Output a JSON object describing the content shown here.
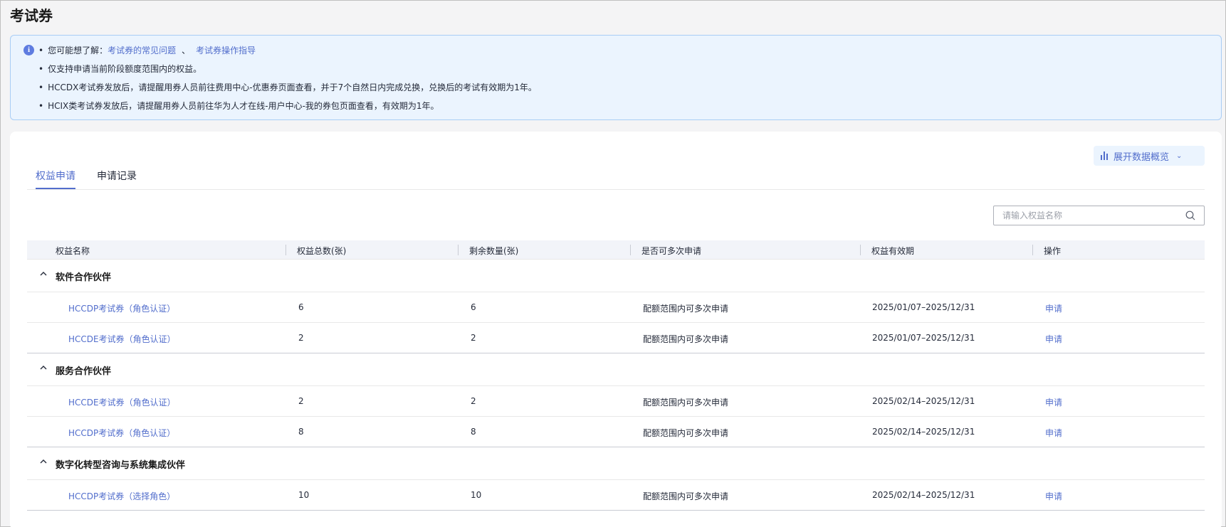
{
  "page": {
    "title": "考试券"
  },
  "notice": {
    "prefix": "您可能想了解：",
    "link1": "考试券的常见问题",
    "separator": "、",
    "link2": "考试券操作指导",
    "lines": [
      "仅支持申请当前阶段额度范围内的权益。",
      "HCCDX考试券发放后，请提醒用券人员前往费用中心-优惠券页面查看，并于7个自然日内完成兑换，兑换后的考试有效期为1年。",
      "HCIX类考试券发放后，请提醒用券人员前往华为人才在线-用户中心-我的券包页面查看，有效期为1年。"
    ]
  },
  "toolbar": {
    "expand_label": "展开数据概览"
  },
  "tabs": [
    {
      "label": "权益申请",
      "active": true
    },
    {
      "label": "申请记录",
      "active": false
    }
  ],
  "search": {
    "placeholder": "请输入权益名称",
    "value": ""
  },
  "table": {
    "columns": [
      "权益名称",
      "权益总数(张)",
      "剩余数量(张)",
      "是否可多次申请",
      "权益有效期",
      "操作"
    ],
    "groups": [
      {
        "name": "软件合作伙伴",
        "rows": [
          {
            "name": "HCCDP考试券（角色认证）",
            "total": "6",
            "remaining": "6",
            "multi": "配额范围内可多次申请",
            "validity": "2025/01/07–2025/12/31",
            "action": "申请"
          },
          {
            "name": "HCCDE考试券（角色认证）",
            "total": "2",
            "remaining": "2",
            "multi": "配额范围内可多次申请",
            "validity": "2025/01/07–2025/12/31",
            "action": "申请"
          }
        ]
      },
      {
        "name": "服务合作伙伴",
        "rows": [
          {
            "name": "HCCDE考试券（角色认证）",
            "total": "2",
            "remaining": "2",
            "multi": "配额范围内可多次申请",
            "validity": "2025/02/14–2025/12/31",
            "action": "申请"
          },
          {
            "name": "HCCDP考试券（角色认证）",
            "total": "8",
            "remaining": "8",
            "multi": "配额范围内可多次申请",
            "validity": "2025/02/14–2025/12/31",
            "action": "申请"
          }
        ]
      },
      {
        "name": "数字化转型咨询与系统集成伙伴",
        "rows": [
          {
            "name": "HCCDP考试券（选择角色）",
            "total": "10",
            "remaining": "10",
            "multi": "配额范围内可多次申请",
            "validity": "2025/02/14–2025/12/31",
            "action": "申请"
          }
        ]
      }
    ]
  }
}
